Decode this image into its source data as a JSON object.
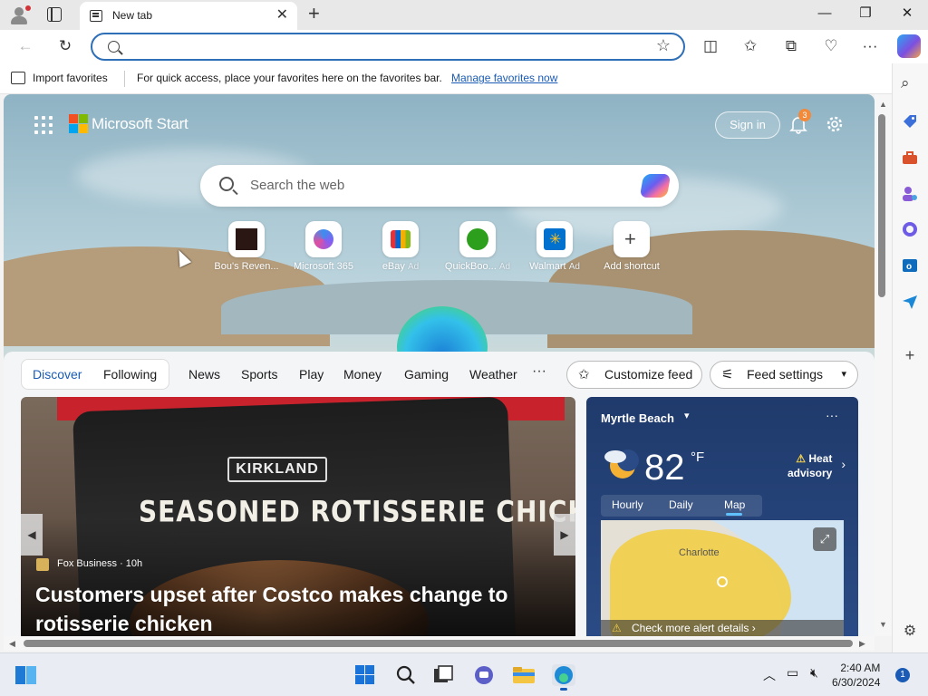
{
  "browser": {
    "tab_title": "New tab",
    "tab_close": "✕",
    "new_tab": "+",
    "window_controls": {
      "minimize": "—",
      "restore": "❐",
      "close": "✕"
    },
    "address_placeholder": "",
    "address_value": ""
  },
  "favorites_bar": {
    "import_label": "Import favorites",
    "message": "For quick access, place your favorites here on the favorites bar.",
    "manage_link": "Manage favorites now"
  },
  "start_page": {
    "brand": "Microsoft Start",
    "sign_in": "Sign in",
    "notification_count": "3",
    "search_placeholder": "Search the web",
    "shortcuts": [
      {
        "label": "Bou's Reven...",
        "ad": "",
        "icon": "bou-icon"
      },
      {
        "label": "Microsoft 365",
        "ad": "",
        "icon": "m365-icon"
      },
      {
        "label": "eBay",
        "ad": "Ad",
        "icon": "ebay-icon"
      },
      {
        "label": "QuickBoo...",
        "ad": "Ad",
        "icon": "quickbooks-icon"
      },
      {
        "label": "Walmart",
        "ad": "Ad",
        "icon": "walmart-icon"
      },
      {
        "label": "Add shortcut",
        "ad": "",
        "icon": "plus-icon"
      }
    ]
  },
  "feed": {
    "pills": [
      "Discover",
      "Following"
    ],
    "nav": [
      "News",
      "Sports",
      "Play",
      "Money",
      "Gaming",
      "Weather"
    ],
    "more": "···",
    "customize": "Customize feed",
    "settings": "Feed settings"
  },
  "hero": {
    "brand_badge": "KIRKLAND",
    "package_text": "SEASONED ROTISSERIE CHICKEN",
    "source": "Fox Business · 10h",
    "headline": "Customers upset after Costco makes change to rotisserie chicken"
  },
  "weather": {
    "location": "Myrtle Beach",
    "temperature": "82",
    "unit": "°F",
    "alert_line1": "Heat",
    "alert_line2": "advisory",
    "tabs": [
      "Hourly",
      "Daily",
      "Map"
    ],
    "active_tab": "Map",
    "map_city": "Charlotte",
    "alert_details": "Check more alert details",
    "alert_color": "#f1ce4a"
  },
  "taskbar": {
    "time": "2:40 AM",
    "date": "6/30/2024",
    "notification_count": "1"
  },
  "colors": {
    "accent": "#1a5bb5",
    "address_border": "#2f6fb7",
    "notification_badge": "#f18a3b"
  }
}
